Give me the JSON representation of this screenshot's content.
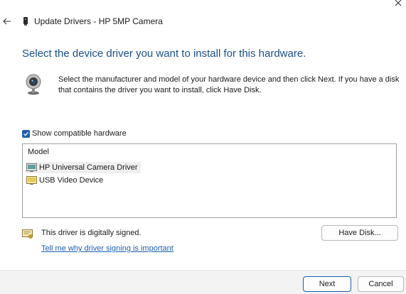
{
  "window": {
    "title": "Update Drivers - HP 5MP Camera"
  },
  "heading": "Select the device driver you want to install for this hardware.",
  "intro": "Select the manufacturer and model of your hardware device and then click Next. If you have a disk that contains the driver you want to install, click Have Disk.",
  "compatible": {
    "label": "Show compatible hardware",
    "checked": true
  },
  "model_list": {
    "header": "Model",
    "items": [
      {
        "label": "HP Universal Camera Driver",
        "selected": true
      },
      {
        "label": "USB Video Device",
        "selected": false
      }
    ]
  },
  "signing": {
    "status": "This driver is digitally signed.",
    "link": "Tell me why driver signing is important"
  },
  "buttons": {
    "have_disk": "Have Disk...",
    "next": "Next",
    "cancel": "Cancel"
  },
  "icons": {
    "close": "close-icon",
    "back": "back-arrow-icon",
    "device": "camera-device-icon",
    "webcam": "webcam-icon",
    "driver": "driver-icon",
    "certificate": "certificate-icon"
  },
  "colors": {
    "heading": "#1a4f8a",
    "accent": "#1f5fb0",
    "link": "#1a5fb4"
  }
}
